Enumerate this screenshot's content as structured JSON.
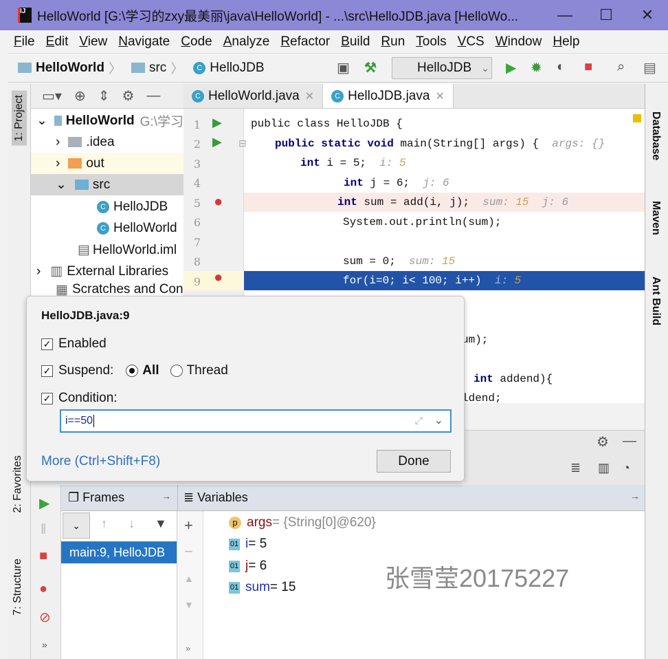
{
  "window": {
    "title": "HelloWorld [G:\\学习的zxy最美丽\\java\\HelloWorld] - ...\\src\\HelloJDB.java [HelloWo...",
    "minimize": "—",
    "maximize": "☐",
    "close": "✕"
  },
  "menu": [
    "File",
    "Edit",
    "View",
    "Navigate",
    "Code",
    "Analyze",
    "Refactor",
    "Build",
    "Run",
    "Tools",
    "VCS",
    "Window",
    "Help"
  ],
  "breadcrumb": [
    "HelloWorld",
    "src",
    "HelloJDB"
  ],
  "run_config": "HelloJDB",
  "left_tabs": {
    "project": "1: Project",
    "favorites": "2: Favorites",
    "structure": "7: Structure"
  },
  "right_tabs": {
    "database": "Database",
    "maven": "Maven",
    "ant": "Ant Build"
  },
  "project_tree": [
    {
      "label": "HelloWorld",
      "extra": "G:\\学习",
      "bold": true
    },
    {
      "label": ".idea"
    },
    {
      "label": "out"
    },
    {
      "label": "src"
    },
    {
      "label": "HelloJDB"
    },
    {
      "label": "HelloWorld"
    },
    {
      "label": "HelloWorld.iml"
    },
    {
      "label": "External Libraries"
    },
    {
      "label": "Scratches and Con"
    }
  ],
  "tabs": [
    {
      "label": "HelloWorld.java"
    },
    {
      "label": "HelloJDB.java",
      "active": true
    }
  ],
  "code": {
    "l1": "public class HelloJDB {",
    "l2a": "public static void",
    "l2b": " main(String[] args) {  ",
    "l2h": "args: {}",
    "l3a": "int",
    "l3b": " i = 5;  ",
    "l3h": "i: ",
    "l3v": "5",
    "l4a": "int",
    "l4b": " j = 6;  ",
    "l4h": "j: 6",
    "l5a": "int",
    "l5b": " sum = add(i, j);  ",
    "l5h": "sum: ",
    "l5v": "15",
    "l5h2": "  j: 6",
    "l6": "System.out.println(sum);",
    "l8a": "sum = 0;  ",
    "l8h": "sum: ",
    "l8v": "15",
    "l9a": "for(i=0; i< 100; i++)  ",
    "l9h": "i: ",
    "l9v": "5",
    "frag1": "um);",
    "frag2a": "int",
    "frag2b": " addend){",
    "frag3": "ldend;"
  },
  "line_numbers": [
    "1",
    "2",
    "3",
    "4",
    "5",
    "6",
    "7",
    "8",
    "9"
  ],
  "popup": {
    "title": "HelloJDB.java:9",
    "enabled": "Enabled",
    "suspend": "Suspend:",
    "all": "All",
    "thread": "Thread",
    "condition": "Condition:",
    "condition_value": "i==50",
    "more": "More (Ctrl+Shift+F8)",
    "done": "Done"
  },
  "debug": {
    "frames_label": "Frames",
    "variables_label": "Variables",
    "frame": "main:9, HelloJDB",
    "variables": [
      {
        "badge": "p",
        "name": "args",
        "value": " = {String[0]@620}"
      },
      {
        "badge": "01",
        "name": "i",
        "value": " = 5"
      },
      {
        "badge": "01",
        "name": "j",
        "value": " = 6"
      },
      {
        "badge": "01",
        "name": "sum",
        "value": " = 15"
      }
    ]
  },
  "watermark": "张雪莹20175227"
}
